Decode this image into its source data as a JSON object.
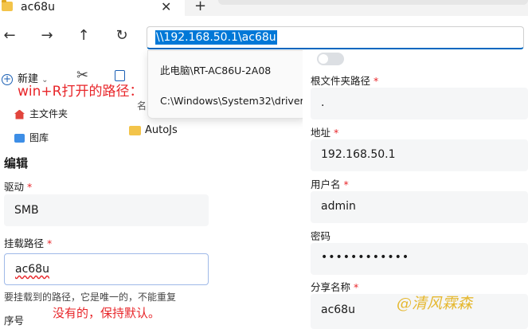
{
  "explorer": {
    "tab_title": "ac68u",
    "tab_close": "✕",
    "new_tab": "+",
    "nav": {
      "back": "←",
      "forward": "→",
      "up": "↑",
      "refresh": "↻"
    },
    "address_value": "\\\\192.168.50.1\\ac68u",
    "toolbar": {
      "new_label": "新建",
      "new_caret": "⌄"
    },
    "sidebar": [
      {
        "label": "主文件夹"
      },
      {
        "label": "图库"
      }
    ],
    "name_column": "名",
    "files": [
      {
        "name": "AutoJs"
      }
    ]
  },
  "dropdown": [
    {
      "text": "此电脑\\RT-AC86U-2A08"
    },
    {
      "text": "C:\\Windows\\System32\\driver"
    }
  ],
  "annotations": {
    "winr": "win+R打开的路径：",
    "keep_default": "没有的，保持默认。"
  },
  "edit_form": {
    "heading": "编辑",
    "drive_label": "驱动",
    "drive_value": "SMB",
    "mount_path_label": "挂载路径",
    "mount_path_value": "ac68u",
    "mount_path_hint": "要挂载到的路径，它是唯一的，不能重复",
    "order_label": "序号",
    "required_mark": "*"
  },
  "settings_form": {
    "root_path_label": "根文件夹路径",
    "root_path_value": ".",
    "address_label": "地址",
    "address_value": "192.168.50.1",
    "username_label": "用户名",
    "username_value": "admin",
    "password_label": "密码",
    "password_value": "••••••••••••",
    "share_name_label": "分享名称",
    "share_name_value": "ac68u",
    "toggle_on": false,
    "required_mark": "*"
  },
  "watermark": "@清风霖森"
}
